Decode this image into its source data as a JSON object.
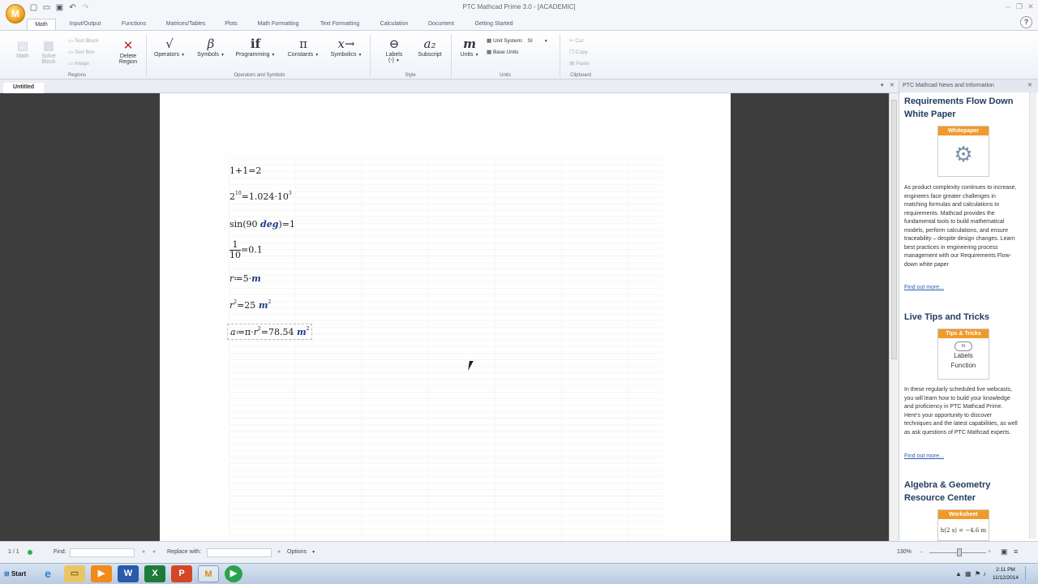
{
  "titlebar": {
    "title": "PTC Mathcad Prime 3.0 - [ACADEMIC]",
    "app_logo": "M",
    "qat_icons": [
      "new-file-icon",
      "open-folder-icon",
      "save-icon",
      "undo-icon",
      "redo-icon"
    ]
  },
  "tabs": [
    "Math",
    "Input/Output",
    "Functions",
    "Matrices/Tables",
    "Plots",
    "Math Formatting",
    "Text Formatting",
    "Calculation",
    "Document",
    "Getting Started"
  ],
  "help_label": "?",
  "ribbon": {
    "regions": {
      "math_label": "Math",
      "solve_label": "Solve Block",
      "text_block": "Text Block",
      "text_box": "Text Box",
      "image": "Image",
      "delete_region": "Delete Region",
      "group_label": "Regions"
    },
    "operators": {
      "operators": "Operators",
      "symbols": "Symbols",
      "programming": "Programming",
      "constants": "Constants",
      "symbolics": "Symbolics",
      "group_label": "Operators and Symbols"
    },
    "style": {
      "labels": "Labels",
      "labels_value": "(-)",
      "subscript": "Subscript",
      "group_label": "Style"
    },
    "units": {
      "units": "Units",
      "unit_system_label": "Unit System:",
      "unit_system_value": "SI",
      "base_units": "Base Units",
      "group_label": "Units"
    },
    "clipboard": {
      "cut": "Cut",
      "copy": "Copy",
      "paste": "Paste",
      "group_label": "Clipboard"
    }
  },
  "document": {
    "tab_name": "Untitled"
  },
  "news": {
    "header": "PTC Mathcad News and Information",
    "items": [
      {
        "title": "Requirements Flow Down White Paper",
        "thumb_band": "Whitepaper",
        "body": "As product complexity continues to increase, engineers face greater challenges in matching formulas and calculations to requirements.  Mathcad provides the fundamental tools to build mathematical models, perform calculations, and ensure traceability – despite design changes. Learn best practices in engineering process management with our Requirements Flow-down white paper",
        "link": "Find out more..."
      },
      {
        "title": "Live Tips and Tricks",
        "thumb_band": "Tips & Tricks",
        "thumb_text1": "Labels",
        "thumb_text2": "Function",
        "body": "In these regularly scheduled live webcasts, you will learn how to build your knowledge and proficiency in PTC Mathcad Prime. Here's your opportunity to discover techniques and the latest capabilities,  as well as ask questions of PTC Mathcad experts.",
        "link": "Find out more..."
      },
      {
        "title": "Algebra & Geometry Resource Center",
        "thumb_band": "Worksheet",
        "thumb_text1": "h(2 s) = −4.6 m"
      }
    ]
  },
  "statusbar": {
    "page": "1 / 1",
    "find_label": "Find:",
    "replace_label": "Replace with:",
    "options": "Options",
    "zoom": "130%"
  },
  "taskbar": {
    "start": "Start",
    "apps": [
      "internet-explorer-icon",
      "file-explorer-icon",
      "media-player-icon",
      "word-icon",
      "excel-icon",
      "powerpoint-icon",
      "mathcad-icon",
      "camtasia-icon"
    ],
    "time": "2:11 PM",
    "date": "11/12/2014"
  },
  "colors": {
    "accent": "#f19a2a",
    "news_title": "#1f3a5f",
    "link": "#2a5cb0",
    "unit": "#223a8a",
    "workspace": "#3d3d3d"
  }
}
